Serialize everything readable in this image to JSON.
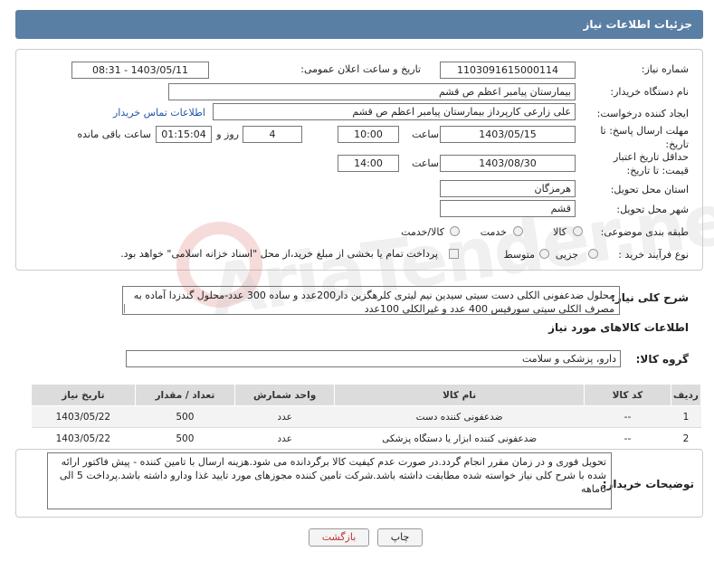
{
  "page_title": "جزئیات اطلاعات نیاز",
  "fields": {
    "need_number_label": "شماره نیاز:",
    "need_number": "1103091615000114",
    "announce_label": "تاریخ و ساعت اعلان عمومی:",
    "announce_value": "1403/05/11 - 08:31",
    "buyer_org_label": "نام دستگاه خریدار:",
    "buyer_org": "بیمارستان پیامبر اعظم  ص  قشم",
    "creator_label": "ایجاد کننده درخواست:",
    "creator": "علی زارعی کارپرداز بیمارستان پیامبر اعظم  ص  قشم",
    "contact_link": "اطلاعات تماس خریدار",
    "deadline_label": "مهلت ارسال پاسخ: تا تاریخ:",
    "deadline_date": "1403/05/15",
    "time_label": "ساعت",
    "deadline_time": "10:00",
    "days_value": "4",
    "days_label": "روز و",
    "remaining_time": "01:15:04",
    "remaining_label": "ساعت باقی مانده",
    "validity_label": "حداقل تاریخ اعتبار قیمت: تا تاریخ:",
    "validity_date": "1403/08/30",
    "validity_time": "14:00",
    "province_label": "استان محل تحویل:",
    "province": "هرمزگان",
    "city_label": "شهر محل تحویل:",
    "city": "قشم",
    "category_label": "طبقه بندی موضوعی:",
    "category_options": [
      "کالا",
      "خدمت",
      "کالا/خدمت"
    ],
    "process_label": "نوع فرآیند خرید :",
    "process_options": [
      "جزیی",
      "متوسط"
    ],
    "payment_note": "پرداخت تمام یا بخشی از مبلغ خرید،از محل \"اسناد خزانه اسلامی\" خواهد بود."
  },
  "summary": {
    "label": "شرح کلی نیاز:",
    "text": "محلول ضدعفونی الکلی دست سیتی سیدین نیم لیتری کلرهگزین دار200عدد و ساده 300 عدد-محلول گندزدا آماده به مصرف الکلی سیتی سورفیس 400 عدد و غیرالکلی 100عدد"
  },
  "goods_info": {
    "title": "اطلاعات کالاهای مورد نیاز",
    "group_label": "گروه کالا:",
    "group_value": "دارو، پزشکی و سلامت"
  },
  "table": {
    "headers": [
      "ردیف",
      "کد کالا",
      "نام کالا",
      "واحد شمارش",
      "تعداد / مقدار",
      "تاریخ نیاز"
    ],
    "rows": [
      {
        "row": "1",
        "code": "--",
        "name": "ضدعفونی کننده دست",
        "unit": "عدد",
        "qty": "500",
        "date": "1403/05/22"
      },
      {
        "row": "2",
        "code": "--",
        "name": "ضدعفونی کننده ابزار یا دستگاه پزشکی",
        "unit": "عدد",
        "qty": "500",
        "date": "1403/05/22"
      }
    ]
  },
  "buyer_notes": {
    "label": "توضیحات خریدار:",
    "text": "تحویل فوری و در زمان مقرر انجام گردد.در صورت عدم کیفیت کالا برگردانده می شود.هزینه ارسال با تامین کننده - پیش فاکتور ارائه شده با شرح کلی نیاز خواسته شده مطابقت داشته باشد.شرکت تامین کننده مجوزهای مورد تایید غذا ودارو داشته باشد.پرداخت 5 الی 6ماهه"
  },
  "buttons": {
    "print": "چاپ",
    "back": "بازگشت"
  },
  "watermark": "AriaTender.net",
  "colors": {
    "header_bg": "#5a7fa4",
    "back_text": "#c03030",
    "link": "#2255aa"
  }
}
